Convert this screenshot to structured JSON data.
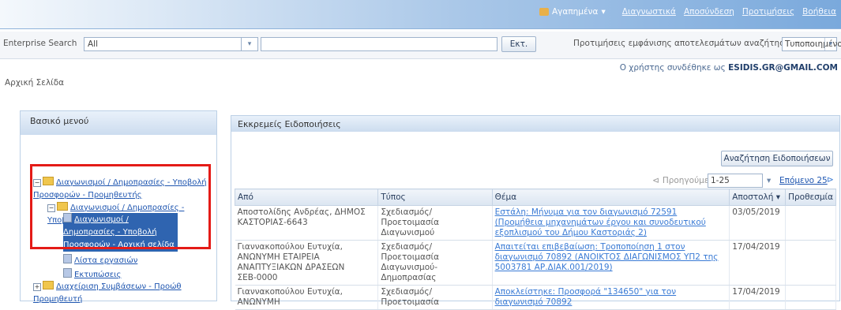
{
  "header": {
    "favorites": "Αγαπημένα",
    "links": [
      "Διαγνωστικά",
      "Αποσύνδεση",
      "Προτιμήσεις",
      "Βοήθεια"
    ]
  },
  "search": {
    "label": "Enterprise Search",
    "scope_value": "All",
    "go_label": "Εκτ.",
    "prefs_label": "Προτιμήσεις εμφάνισης αποτελεσμάτων αναζήτησης",
    "prefs_value": "Τυποποιημένο"
  },
  "user": {
    "prefix": "Ο χρήστης συνδέθηκε ως",
    "email": "ESIDIS.GR@GMAIL.COM"
  },
  "nav": {
    "home": "Αρχική Σελίδα"
  },
  "left_menu": {
    "title": "Βασικό μενού",
    "items": [
      "Διαγωνισμοί / Δημοπρασίες - Υποβολή Προσφορών - Προμηθευτής",
      "Διαγωνισμοί / Δημοπρασίες - Υποβολή Προσφορών",
      "Διαγωνισμοί / Δημοπρασίες - Υποβολή Προσφορών - Αρχική σελίδα",
      "Λίστα εργασιών",
      "Εκτυπώσεις",
      "Διαχείριση Συμβάσεων - Προώθ Προμηθευτή"
    ]
  },
  "notifications": {
    "title": "Εκκρεμείς Ειδοποιήσεις",
    "search_button": "Αναζήτηση Ειδοποιήσεων",
    "prev_label": "Προηγούμενο",
    "range_value": "1-25",
    "next_label": "Επόμενο 25",
    "columns": [
      "Από",
      "Τύπος",
      "Θέμα",
      "Αποστολή",
      "Προθεσμία"
    ],
    "rows": [
      {
        "from": "Αποστολίδης Ανδρέας, ΔΗΜΟΣ ΚΑΣΤΟΡΙΑΣ-6643",
        "type": "Σχεδιασμός/Προετοιμασία Διαγωνισμού",
        "subject": "Εστάλη: Μήνυμα για τον διαγωνισμό 72591 (Προμήθεια μηχανημάτων έργου και συνοδευτικού εξοπλισμού του Δήμου Καστοριάς 2)",
        "sent": "03/05/2019",
        "due": ""
      },
      {
        "from": "Γιαννακοπούλου Ευτυχία, ΑΝΩΝΥΜΗ ΕΤΑΙΡΕΙΑ ΑΝΑΠΤΥΞΙΑΚΩΝ ΔΡΑΣΕΩΝ ΣΕΒ-0000",
        "type": "Σχεδιασμός/Προετοιμασία Διαγωνισμού-Δημοπρασίας",
        "subject": "Απαιτείται επιβεβαίωση: Τροποποίηση 1 στον διαγωνισμό 70892 (ΑΝΟΙΚΤΟΣ ΔΙΑΓΩΝΙΣΜΟΣ ΥΠ2 της 5003781 ΑΡ.ΔΙΑΚ.001/2019)",
        "sent": "17/04/2019",
        "due": ""
      },
      {
        "from": "Γιαννακοπούλου Ευτυχία, ΑΝΩΝΥΜΗ",
        "type": "Σχεδιασμός/Προετοιμασία",
        "subject": "Αποκλείστηκε: Προσφορά \"134650\" για τον διαγωνισμό 70892",
        "sent": "17/04/2019",
        "due": ""
      }
    ]
  }
}
